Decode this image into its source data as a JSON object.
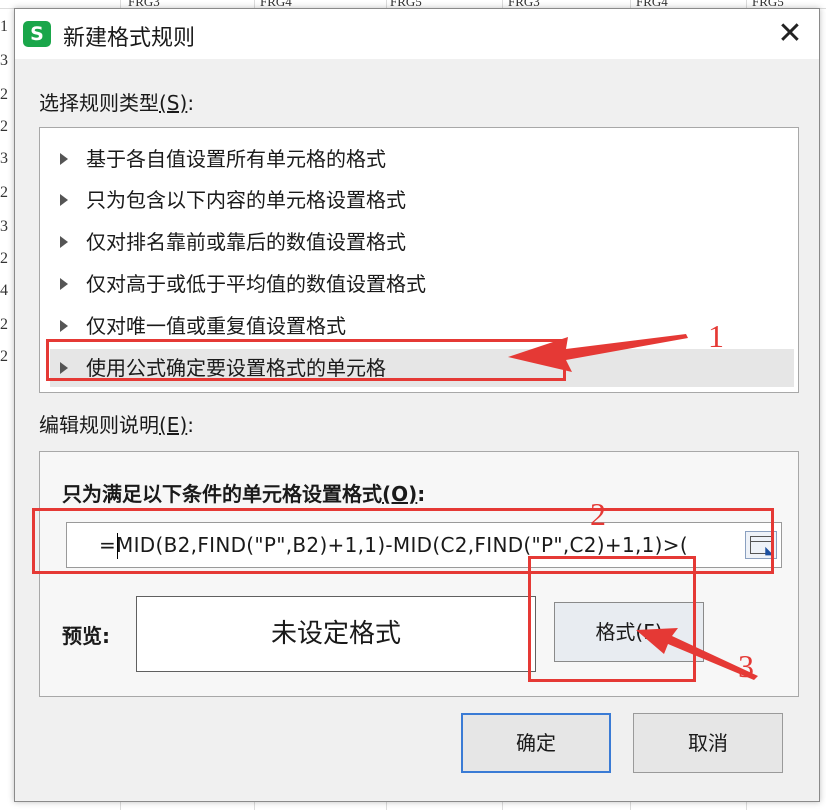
{
  "background_sheet": {
    "column_headers": [
      "FRG3",
      "FRG4",
      "FRG5",
      "FRG3",
      "FRG4",
      "FRG5"
    ],
    "row_stubs": [
      "1",
      "3",
      "2",
      "2",
      "3",
      "2",
      "3",
      "2",
      "4",
      "2",
      "2"
    ]
  },
  "dialog": {
    "app_icon_glyph": "S",
    "title": "新建格式规则",
    "close_glyph": "✕"
  },
  "rule_type": {
    "label_text": "选择规则类型",
    "label_key": "(S)",
    "label_colon": ":",
    "items": [
      "基于各自值设置所有单元格的格式",
      "只为包含以下内容的单元格设置格式",
      "仅对排名靠前或靠后的数值设置格式",
      "仅对高于或低于平均值的数值设置格式",
      "仅对唯一值或重复值设置格式",
      "使用公式确定要设置格式的单元格"
    ],
    "selected_index": 5
  },
  "edit_rule": {
    "label_text": "编辑规则说明",
    "label_key": "(E)",
    "label_colon": ":",
    "condition_label_text": "只为满足以下条件的单元格设置格式",
    "condition_label_key": "(O)",
    "condition_label_colon": ":",
    "formula_value": "=MID(B2,FIND(\"P\",B2)+1,1)-MID(C2,FIND(\"P\",C2)+1,1)>(",
    "preview_label": "预览:",
    "preview_text": "未设定格式",
    "format_button": "格式(F)"
  },
  "buttons": {
    "ok": "确定",
    "cancel": "取消"
  },
  "annotations": {
    "color": "#e53935",
    "numbers": [
      "1",
      "2",
      "3"
    ]
  }
}
